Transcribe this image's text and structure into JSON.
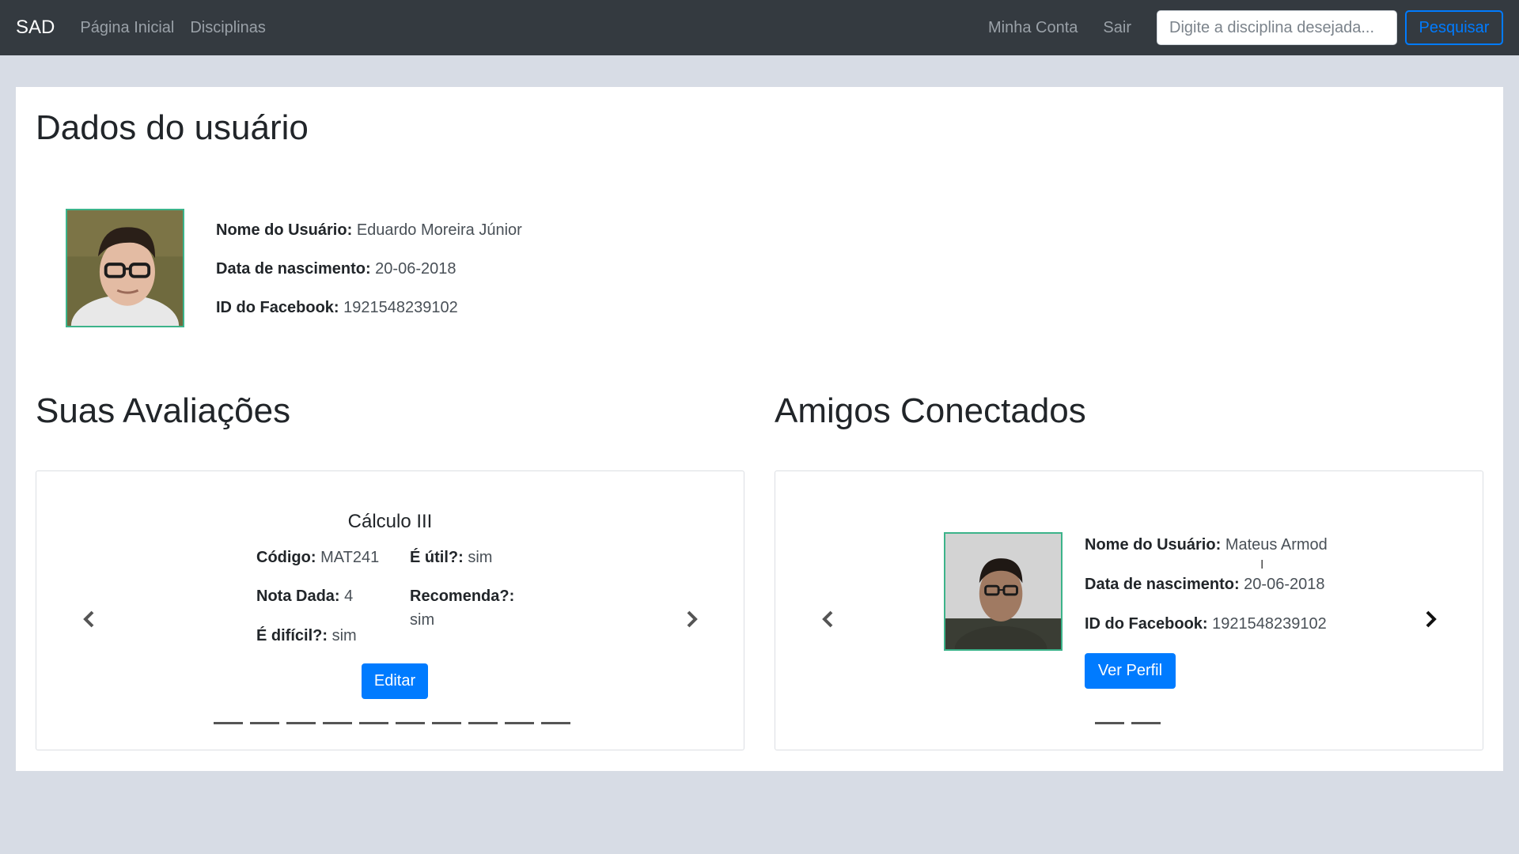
{
  "navbar": {
    "brand": "SAD",
    "links": [
      "Página Inicial",
      "Disciplinas"
    ],
    "account": "Minha Conta",
    "logout": "Sair",
    "search_placeholder": "Digite a disciplina desejada...",
    "search_button": "Pesquisar"
  },
  "user": {
    "heading": "Dados do usuário",
    "name_label": "Nome do Usuário:",
    "name": "Eduardo Moreira Júnior",
    "birth_label": "Data de nascimento:",
    "birth": "20-06-2018",
    "fb_label": "ID do Facebook:",
    "fb": "1921548239102"
  },
  "evaluations": {
    "heading": "Suas Avaliações",
    "title": "Cálculo III",
    "code_label": "Código:",
    "code": "MAT241",
    "useful_label": "É útil?:",
    "useful": "sim",
    "grade_label": "Nota Dada:",
    "grade": "4",
    "recommend_label": "Recomenda?:",
    "recommend": "sim",
    "hard_label": "É difícil?:",
    "hard": "sim",
    "edit_button": "Editar",
    "slide_count": 10
  },
  "friends": {
    "heading": "Amigos Conectados",
    "name_label": "Nome do Usuário:",
    "name": "Mateus Armod",
    "birth_label": "Data de nascimento:",
    "birth": "20-06-2018",
    "fb_label": "ID do Facebook:",
    "fb": "1921548239102",
    "profile_button": "Ver Perfil",
    "slide_count": 2
  },
  "colors": {
    "navbar": "#343a40",
    "primary": "#007bff",
    "avatar_border": "#3cb38a",
    "page_bg": "#d7dce5"
  },
  "icons": [
    "chevron-left-icon",
    "chevron-right-icon"
  ]
}
